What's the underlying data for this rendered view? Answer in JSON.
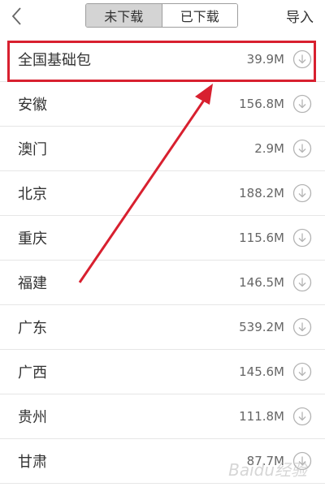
{
  "header": {
    "tabs": [
      {
        "label": "未下载",
        "active": true
      },
      {
        "label": "已下载",
        "active": false
      }
    ],
    "import_label": "导入"
  },
  "items": [
    {
      "name": "全国基础包",
      "size": "39.9M"
    },
    {
      "name": "安徽",
      "size": "156.8M"
    },
    {
      "name": "澳门",
      "size": "2.9M"
    },
    {
      "name": "北京",
      "size": "188.2M"
    },
    {
      "name": "重庆",
      "size": "115.6M"
    },
    {
      "name": "福建",
      "size": "146.5M"
    },
    {
      "name": "广东",
      "size": "539.2M"
    },
    {
      "name": "广西",
      "size": "145.6M"
    },
    {
      "name": "贵州",
      "size": "111.8M"
    },
    {
      "name": "甘肃",
      "size": "87.7M"
    }
  ],
  "icons": {
    "back": "chevron-left-icon",
    "download": "download-circle-icon"
  },
  "colors": {
    "highlight": "#d8202f",
    "active_tab_bg": "#d4d4d4"
  },
  "watermark": "Baidu经验"
}
